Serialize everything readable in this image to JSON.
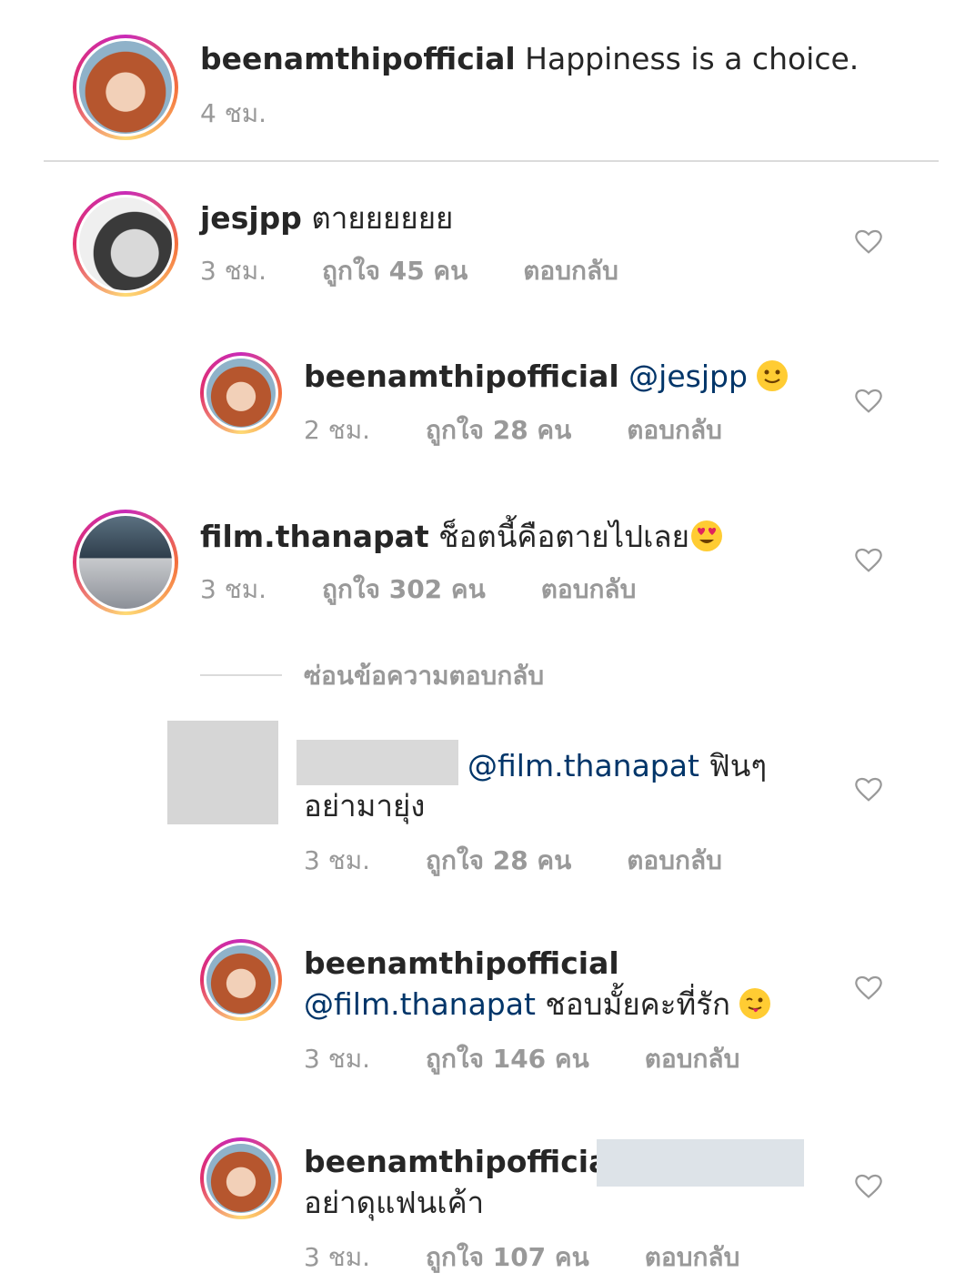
{
  "post": {
    "username": "beenamthipofficial",
    "caption": "Happiness is a choice.",
    "time": "4 ชม."
  },
  "comments": [
    {
      "username": "jesjpp",
      "text": "ตายยยยยย",
      "time": "3 ชม.",
      "likes": "ถูกใจ 45 คน",
      "reply": "ตอบกลับ"
    },
    {
      "username": "beenamthipofficial",
      "mention": "@jesjpp",
      "emoji": "slightly-smiling-face",
      "time": "2 ชม.",
      "likes": "ถูกใจ 28 คน",
      "reply": "ตอบกลับ"
    },
    {
      "username": "film.thanapat",
      "text": "ช็อตนี้คือตายไปเลย",
      "emoji": "heart-eyes-face",
      "time": "3 ชม.",
      "likes": "ถูกใจ 302 คน",
      "reply": "ตอบกลับ"
    },
    {
      "hide_replies": "ซ่อนข้อความตอบกลับ"
    },
    {
      "mention": "@film.thanapat",
      "text_line1": "ฟินๆ",
      "text_line2": "อย่ามายุ่ง",
      "time": "3 ชม.",
      "likes": "ถูกใจ 28 คน",
      "reply": "ตอบกลับ"
    },
    {
      "username": "beenamthipofficial",
      "mention": "@film.thanapat",
      "text": "ชอบมั้ยคะที่รัก",
      "emoji": "winking-tongue-face",
      "time": "3 ชม.",
      "likes": "ถูกใจ 146 คน",
      "reply": "ตอบกลับ"
    },
    {
      "username": "beenamthipofficial",
      "text": "อย่าดุแฟนเค้า",
      "time": "3 ชม.",
      "likes": "ถูกใจ 107 คน",
      "reply": "ตอบกลับ"
    }
  ],
  "colors": {
    "text": "#262626",
    "muted": "#999999",
    "mention": "#003569",
    "divider": "#dbdbdb"
  }
}
